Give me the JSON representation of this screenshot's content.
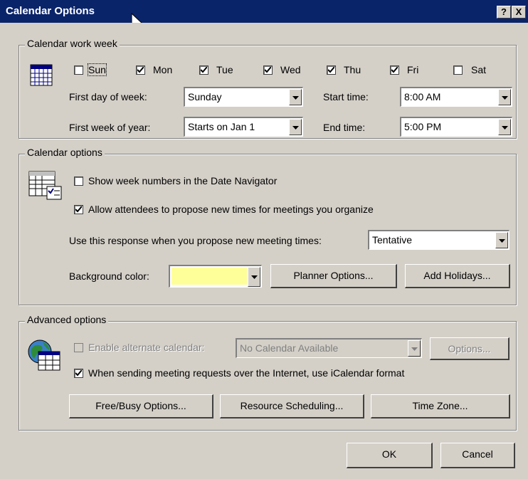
{
  "titlebar": {
    "title": "Calendar Options",
    "help_label": "?",
    "close_label": "X"
  },
  "work_week": {
    "legend": "Calendar work week",
    "days": [
      {
        "label": "Sun",
        "checked": false
      },
      {
        "label": "Mon",
        "checked": true
      },
      {
        "label": "Tue",
        "checked": true
      },
      {
        "label": "Wed",
        "checked": true
      },
      {
        "label": "Thu",
        "checked": true
      },
      {
        "label": "Fri",
        "checked": true
      },
      {
        "label": "Sat",
        "checked": false
      }
    ],
    "first_day_label": "First day of week:",
    "first_day_value": "Sunday",
    "first_week_label": "First week of year:",
    "first_week_value": "Starts on Jan 1",
    "start_time_label": "Start time:",
    "start_time_value": "8:00 AM",
    "end_time_label": "End time:",
    "end_time_value": "5:00 PM"
  },
  "calendar_options": {
    "legend": "Calendar options",
    "show_week_numbers_label": "Show week numbers in the Date Navigator",
    "show_week_numbers_checked": false,
    "allow_propose_label": "Allow attendees to propose new times for meetings you organize",
    "allow_propose_checked": true,
    "response_label": "Use this response when you propose new meeting times:",
    "response_value": "Tentative",
    "background_color_label": "Background color:",
    "background_color": "#ffff99",
    "planner_options_label": "Planner Options...",
    "add_holidays_label": "Add Holidays..."
  },
  "advanced_options": {
    "legend": "Advanced options",
    "alternate_calendar_label": "Enable alternate calendar:",
    "alternate_calendar_checked": false,
    "alternate_calendar_value": "No Calendar Available",
    "alternate_options_label": "Options...",
    "icalendar_label": "When sending meeting requests over the Internet, use iCalendar format",
    "icalendar_checked": true,
    "free_busy_label": "Free/Busy Options...",
    "resource_scheduling_label": "Resource Scheduling...",
    "time_zone_label": "Time Zone..."
  },
  "footer": {
    "ok_label": "OK",
    "cancel_label": "Cancel"
  },
  "colors": {
    "titlebar": "#0a246a",
    "face": "#d4d0c8"
  }
}
